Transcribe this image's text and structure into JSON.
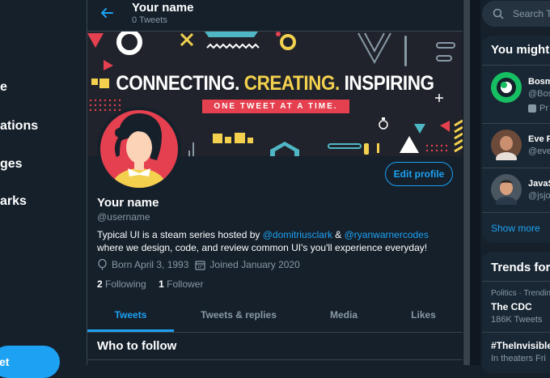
{
  "nav": {
    "items": [
      "e",
      "ations",
      "ges",
      "arks"
    ],
    "tweet_button": "et"
  },
  "header": {
    "name": "Your name",
    "tweet_count": "0 Tweets"
  },
  "banner": {
    "title_part1": "CONNECTING.",
    "title_part2": "CREATING.",
    "title_part3": "INSPIRING",
    "subtitle": "ONE TWEET AT A TIME."
  },
  "profile": {
    "edit_button": "Edit profile",
    "name": "Your name",
    "handle": "@username",
    "bio_pre": "Typical UI is a steam series hosted by ",
    "bio_link1": "@domitriusclark",
    "bio_mid": " & ",
    "bio_link2": "@ryanwarnercodes",
    "bio_post": " where we design, code, and review common UI's you'll experience everyday!",
    "born": "Born April 3, 1993",
    "joined": "Joined January 2020",
    "following_count": "2",
    "following_label": "Following",
    "follower_count": "1",
    "follower_label": "Follower"
  },
  "tabs": [
    "Tweets",
    "Tweets & replies",
    "Media",
    "Likes"
  ],
  "who_to_follow": "Who to follow",
  "sidebar": {
    "search_placeholder": "Search T",
    "you_might": "You might",
    "suggestions": [
      {
        "name": "Bosm",
        "handle": "@Bos",
        "extra": "Pr"
      },
      {
        "name": "Eve P",
        "handle": "@eve"
      },
      {
        "name": "JavaS",
        "handle": "@jsjo"
      }
    ],
    "show_more": "Show more",
    "trends_title": "Trends for",
    "trends": [
      {
        "category": "Politics · Trendin",
        "name": "The CDC",
        "count": "186K Tweets"
      },
      {
        "category": "",
        "name": "#TheInvisible",
        "count": "In theaters Fri"
      }
    ]
  },
  "colors": {
    "background": "#15202b",
    "accent": "#1da1f2",
    "banner_yellow": "#f3d14e",
    "banner_red": "#e5404f",
    "muted": "#8899a6"
  }
}
